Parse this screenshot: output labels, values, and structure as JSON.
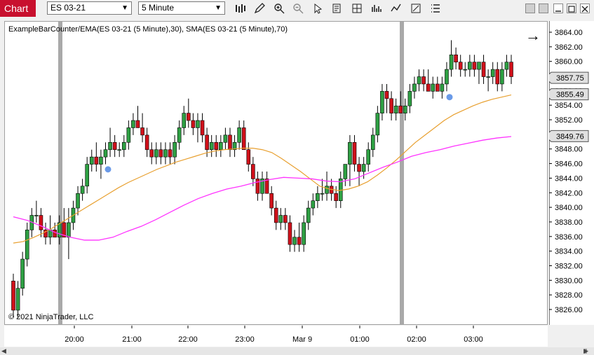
{
  "toolbar": {
    "chart_tab": "Chart",
    "instrument": "ES 03-21",
    "interval": "5 Minute"
  },
  "chart": {
    "indicator_label": "ExampleBarCounter/EMA(ES 03-21 (5 Minute),30), SMA(ES 03-21 (5 Minute),70)",
    "copyright": "© 2021 NinjaTrader, LLC",
    "price_ticks": [
      "3864.00",
      "3862.00",
      "3860.00",
      "3858.00",
      "3856.00",
      "3854.00",
      "3852.00",
      "3850.00",
      "3848.00",
      "3846.00",
      "3844.00",
      "3842.00",
      "3840.00",
      "3838.00",
      "3836.00",
      "3834.00",
      "3832.00",
      "3830.00",
      "3828.00",
      "3826.00"
    ],
    "time_ticks": [
      "20:00",
      "21:00",
      "22:00",
      "23:00",
      "Mar 9",
      "01:00",
      "02:00",
      "03:00"
    ],
    "price_markers": [
      {
        "label": "3857.75",
        "color": "#e0e0e0"
      },
      {
        "label": "3855.49",
        "color": "#e0e0e0"
      },
      {
        "label": "3849.76",
        "color": "#e0e0e0"
      }
    ],
    "colors": {
      "up": "#2ea043",
      "down": "#d0101a",
      "ema": "#e8a030",
      "sma": "#ff33ff",
      "marker_dot": "#6a9ae8",
      "separator": "#a9a9a9"
    }
  },
  "chart_data": {
    "type": "candlestick",
    "ylim": [
      3825,
      3866
    ],
    "candles": [
      [
        3830,
        3831,
        3825,
        3826
      ],
      [
        3826,
        3830,
        3825,
        3829
      ],
      [
        3829,
        3834,
        3828,
        3833
      ],
      [
        3833,
        3838,
        3832,
        3837
      ],
      [
        3837,
        3840,
        3836,
        3839
      ],
      [
        3839,
        3841,
        3838,
        3839
      ],
      [
        3839,
        3840,
        3836,
        3837
      ],
      [
        3837,
        3838,
        3835,
        3836
      ],
      [
        3836,
        3839,
        3835,
        3837
      ],
      [
        3837,
        3838,
        3836,
        3836
      ],
      [
        3836,
        3839,
        3835,
        3838
      ],
      [
        3838,
        3840,
        3836,
        3836
      ],
      [
        3836,
        3840,
        3833,
        3838
      ],
      [
        3838,
        3841,
        3837,
        3840
      ],
      [
        3840,
        3843,
        3839,
        3842
      ],
      [
        3842,
        3844,
        3841,
        3843
      ],
      [
        3843,
        3847,
        3842,
        3846
      ],
      [
        3846,
        3848,
        3845,
        3847
      ],
      [
        3847,
        3849,
        3845,
        3846
      ],
      [
        3846,
        3848,
        3844,
        3847
      ],
      [
        3847,
        3849,
        3846,
        3848
      ],
      [
        3848,
        3851,
        3847,
        3849
      ],
      [
        3849,
        3850,
        3847,
        3848
      ],
      [
        3848,
        3849,
        3847,
        3848
      ],
      [
        3848,
        3850,
        3847,
        3849
      ],
      [
        3849,
        3852,
        3848,
        3851
      ],
      [
        3851,
        3853,
        3850,
        3852
      ],
      [
        3852,
        3854,
        3851,
        3851
      ],
      [
        3851,
        3853,
        3849,
        3850
      ],
      [
        3850,
        3851,
        3847,
        3848
      ],
      [
        3848,
        3849,
        3846,
        3847
      ],
      [
        3847,
        3849,
        3846,
        3848
      ],
      [
        3848,
        3849,
        3846,
        3847
      ],
      [
        3847,
        3849,
        3846,
        3848
      ],
      [
        3848,
        3849,
        3846,
        3847
      ],
      [
        3847,
        3850,
        3846,
        3849
      ],
      [
        3849,
        3852,
        3848,
        3851
      ],
      [
        3851,
        3854,
        3850,
        3853
      ],
      [
        3853,
        3855,
        3851,
        3852
      ],
      [
        3852,
        3853,
        3850,
        3851
      ],
      [
        3851,
        3853,
        3849,
        3852
      ],
      [
        3852,
        3853,
        3849,
        3850
      ],
      [
        3850,
        3851,
        3847,
        3848
      ],
      [
        3848,
        3850,
        3847,
        3849
      ],
      [
        3849,
        3850,
        3847,
        3848
      ],
      [
        3848,
        3850,
        3847,
        3849
      ],
      [
        3849,
        3851,
        3848,
        3850
      ],
      [
        3850,
        3851,
        3847,
        3848
      ],
      [
        3848,
        3850,
        3847,
        3849
      ],
      [
        3849,
        3852,
        3848,
        3851
      ],
      [
        3851,
        3852,
        3848,
        3848
      ],
      [
        3848,
        3849,
        3845,
        3846
      ],
      [
        3846,
        3847,
        3843,
        3844
      ],
      [
        3844,
        3845,
        3841,
        3842
      ],
      [
        3842,
        3845,
        3841,
        3844
      ],
      [
        3844,
        3845,
        3842,
        3842
      ],
      [
        3842,
        3843,
        3839,
        3840
      ],
      [
        3840,
        3841,
        3837,
        3838
      ],
      [
        3838,
        3840,
        3837,
        3839
      ],
      [
        3839,
        3840,
        3837,
        3838
      ],
      [
        3838,
        3839,
        3834,
        3835
      ],
      [
        3835,
        3837,
        3834,
        3836
      ],
      [
        3836,
        3838,
        3834,
        3835
      ],
      [
        3835,
        3839,
        3834,
        3838
      ],
      [
        3838,
        3841,
        3837,
        3840
      ],
      [
        3840,
        3842,
        3839,
        3841
      ],
      [
        3841,
        3843,
        3840,
        3842
      ],
      [
        3842,
        3844,
        3841,
        3842
      ],
      [
        3842,
        3845,
        3841,
        3843
      ],
      [
        3843,
        3844,
        3841,
        3842
      ],
      [
        3842,
        3843,
        3840,
        3841
      ],
      [
        3841,
        3845,
        3840,
        3844
      ],
      [
        3844,
        3846,
        3843,
        3846
      ],
      [
        3846,
        3850,
        3843,
        3849
      ],
      [
        3849,
        3850,
        3845,
        3846
      ],
      [
        3846,
        3847,
        3843,
        3845
      ],
      [
        3845,
        3847,
        3844,
        3846
      ],
      [
        3846,
        3849,
        3845,
        3848
      ],
      [
        3848,
        3851,
        3847,
        3850
      ],
      [
        3850,
        3854,
        3849,
        3853
      ],
      [
        3853,
        3857,
        3852,
        3856
      ],
      [
        3856,
        3857,
        3853,
        3855
      ],
      [
        3855,
        3856,
        3852,
        3853
      ],
      [
        3853,
        3855,
        3852,
        3854
      ],
      [
        3854,
        3856,
        3853,
        3853
      ],
      [
        3853,
        3855,
        3852,
        3854
      ],
      [
        3854,
        3857,
        3853,
        3856
      ],
      [
        3856,
        3858,
        3855,
        3857
      ],
      [
        3857,
        3859,
        3856,
        3858
      ],
      [
        3858,
        3859,
        3856,
        3857
      ],
      [
        3857,
        3859,
        3856,
        3856
      ],
      [
        3856,
        3858,
        3855,
        3857
      ],
      [
        3857,
        3858,
        3856,
        3856
      ],
      [
        3856,
        3858,
        3855,
        3857
      ],
      [
        3857,
        3860,
        3856,
        3859
      ],
      [
        3859,
        3863,
        3858,
        3861
      ],
      [
        3861,
        3862,
        3859,
        3860
      ],
      [
        3860,
        3861,
        3858,
        3859
      ],
      [
        3859,
        3860,
        3858,
        3859
      ],
      [
        3859,
        3861,
        3858,
        3860
      ],
      [
        3860,
        3861,
        3858,
        3859
      ],
      [
        3859,
        3860,
        3857,
        3860
      ],
      [
        3860,
        3861,
        3857,
        3858
      ],
      [
        3858,
        3859,
        3856,
        3858
      ],
      [
        3858,
        3860,
        3857,
        3859
      ],
      [
        3859,
        3860,
        3856,
        3857
      ],
      [
        3857,
        3860,
        3856,
        3859
      ],
      [
        3859,
        3861,
        3858,
        3860
      ],
      [
        3860,
        3861,
        3857,
        3858
      ]
    ],
    "ema": [
      3835.2,
      3835.4,
      3835.9,
      3836.5,
      3837.2,
      3838.0,
      3838.8,
      3839.6,
      3840.4,
      3841.2,
      3842.0,
      3842.8,
      3843.5,
      3844.1,
      3844.7,
      3845.3,
      3845.8,
      3846.3,
      3846.7,
      3847.1,
      3847.5,
      3847.8,
      3848.0,
      3848.1,
      3848.2,
      3848.2,
      3848.0,
      3847.6,
      3846.8,
      3845.9,
      3845.0,
      3844.0,
      3843.0,
      3842.6,
      3842.4,
      3842.6,
      3843.0,
      3843.6,
      3844.5,
      3845.5,
      3846.6,
      3847.8,
      3849.0,
      3850.0,
      3851.0,
      3852.0,
      3852.8,
      3853.4,
      3854.0,
      3854.5,
      3854.9,
      3855.2,
      3855.5
    ],
    "sma": [
      3838.8,
      3838.3,
      3837.5,
      3836.6,
      3836.0,
      3835.6,
      3835.6,
      3836.0,
      3836.8,
      3837.5,
      3838.4,
      3839.4,
      3840.4,
      3841.3,
      3842.0,
      3842.6,
      3843.0,
      3843.5,
      3843.9,
      3844.2,
      3844.1,
      3844.0,
      3843.7,
      3843.6,
      3844.0,
      3844.8,
      3845.6,
      3846.3,
      3847.1,
      3847.6,
      3848.0,
      3848.5,
      3848.9,
      3849.3,
      3849.6,
      3849.8
    ]
  }
}
